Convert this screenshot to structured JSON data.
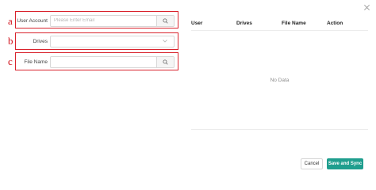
{
  "annotations": {
    "a": "a",
    "b": "b",
    "c": "c"
  },
  "form": {
    "user_account": {
      "label": "User Account",
      "value": "",
      "placeholder": "Please Enter Email",
      "icon": "search-icon"
    },
    "drives": {
      "label": "Drives",
      "selected": "",
      "icon": "chevron-down-icon"
    },
    "file_name": {
      "label": "File Name",
      "value": "",
      "placeholder": "",
      "icon": "search-icon"
    }
  },
  "table": {
    "columns": [
      "User",
      "Drives",
      "File Name",
      "Action"
    ],
    "rows": [],
    "empty_text": "No Data"
  },
  "footer": {
    "cancel_label": "Cancel",
    "save_label": "Save and Sync"
  },
  "colors": {
    "highlight": "#d9232d",
    "primary": "#1f9e8e"
  }
}
